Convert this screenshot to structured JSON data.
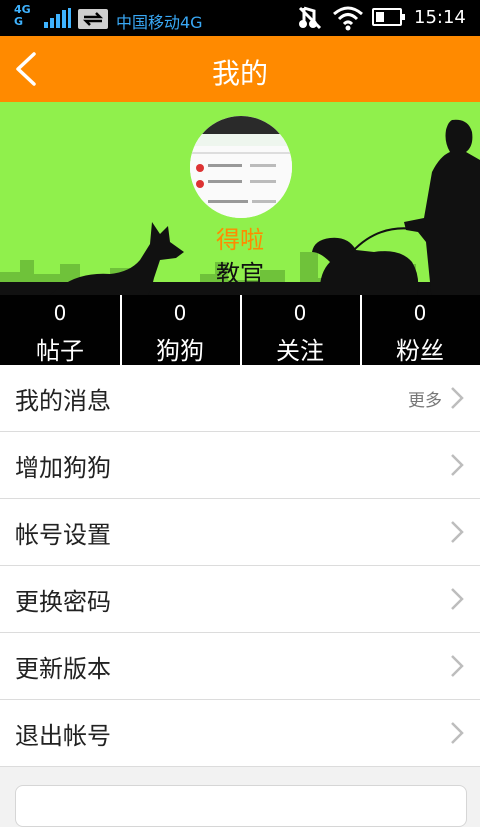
{
  "status_bar": {
    "network_type": "4G",
    "network_type_2": "G",
    "carrier": "中国移动4G",
    "time": "15:14",
    "icons": [
      "signal-icon",
      "data-transfer-icon",
      "mute-icon",
      "wifi-icon",
      "battery-icon"
    ]
  },
  "header": {
    "title": "我的",
    "back_icon": "chevron-left-icon"
  },
  "profile": {
    "username": "得啦",
    "rank": "教官",
    "stats": [
      {
        "count": "0",
        "label": "帖子"
      },
      {
        "count": "0",
        "label": "狗狗"
      },
      {
        "count": "0",
        "label": "关注"
      },
      {
        "count": "0",
        "label": "粉丝"
      }
    ]
  },
  "menu": {
    "items": [
      {
        "label": "我的消息",
        "extra": "更多"
      },
      {
        "label": "增加狗狗"
      },
      {
        "label": "帐号设置"
      },
      {
        "label": "更换密码"
      },
      {
        "label": "更新版本"
      },
      {
        "label": "退出帐号"
      }
    ]
  },
  "colors": {
    "accent": "#ff8a00",
    "header_bg": "#90f04c",
    "stats_bg": "#000000"
  }
}
